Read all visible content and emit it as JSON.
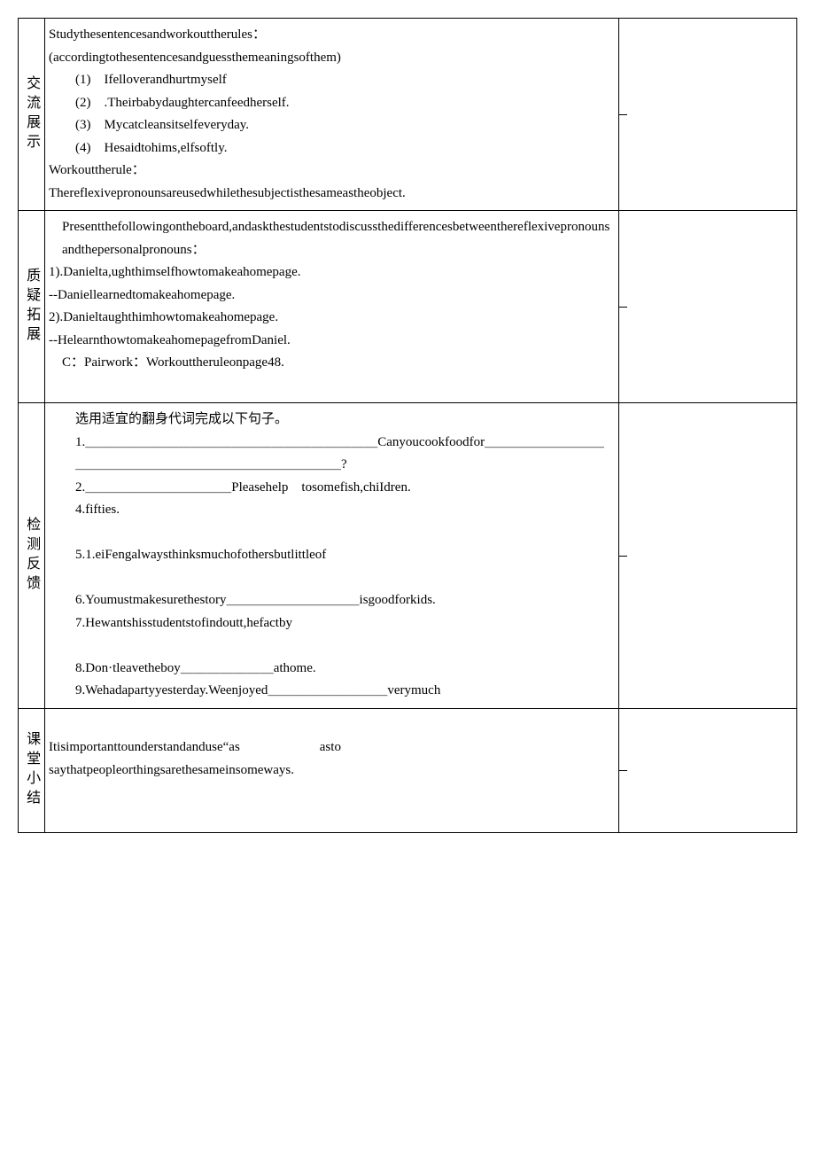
{
  "sections": [
    {
      "label": "交流展示",
      "lines": [
        {
          "text": "Studythesentencesandworkouttherules",
          "suffix": "：",
          "justify": true
        },
        {
          "text": "(accordingtothesentencesandguessthemeaningsofthem)"
        },
        {
          "text": "(1)　Ifelloverandhurtmyself",
          "indent": "indent1"
        },
        {
          "text": "(2)　.Theirbabydaughtercanfeedherself.",
          "indent": "indent1"
        },
        {
          "text": "(3)　Mycatcleansitselfeveryday.",
          "indent": "indent1"
        },
        {
          "text": "(4)　Hesaidtohims,elfsoftly.",
          "indent": "indent1"
        },
        {
          "text": "Workouttherule",
          "suffix": "：",
          "justify": true
        },
        {
          "text": "Thereflexivepronounsareusedwhilethesubjectisthesameastheobject."
        }
      ]
    },
    {
      "label": "质疑拓展",
      "lines": [
        {
          "text": "Presentthefollowingontheboard,andaskthestudentstodiscussthedifferencesbetweenthereflexivepronounsandthepersonalpronouns：",
          "indent": "indent-sm"
        },
        {
          "text": "1).Danielta,ughthimselfhowtomakeahomepage."
        },
        {
          "text": "--Daniellearnedtomakeahomepage."
        },
        {
          "text": "2).Danieltaughthimhowtomakeahomepage."
        },
        {
          "text": "--HelearnthowtomakeahomepagefromDaniel."
        },
        {
          "text": "C：Pairwork：Workouttheruleonpage48.",
          "indent": "indent-sm"
        },
        {
          "text": " "
        }
      ]
    },
    {
      "label": "检测反馈",
      "lines": [
        {
          "text": "选用适宜的翻身代词完成以下句子。",
          "indent": "indent1"
        },
        {
          "text": "1.＿＿＿＿＿＿＿＿＿＿＿＿＿＿＿＿＿＿＿＿＿＿Canyoucookfoodfor＿＿＿＿＿＿＿＿＿＿＿＿＿＿＿＿＿＿＿＿＿＿＿＿＿＿＿＿＿?",
          "indent": "indent1"
        },
        {
          "text": "2.＿＿＿＿＿＿＿＿＿＿＿Pleasehelp　tosomefish,chiIdren.",
          "indent": "indent1"
        },
        {
          "text": "4.fifties.",
          "indent": "indent1"
        },
        {
          "text": " "
        },
        {
          "text": "5.1.eiFengalwaysthinksmuchofothersbutlittleof",
          "indent": "indent1"
        },
        {
          "text": " "
        },
        {
          "text": "6.Youmustmakesurethestory＿＿＿＿＿＿＿＿＿＿isgoodforkids.",
          "indent": "indent1"
        },
        {
          "text": "7.Hewantshisstudentstofindoutt,hefactby",
          "indent": "indent1"
        },
        {
          "text": " "
        },
        {
          "text": "8.Don·tleavetheboy＿＿＿＿＿＿＿athome.",
          "indent": "indent1"
        },
        {
          "text": "9.Wehadapartyyesterday.Weenjoyed＿＿＿＿＿＿＿＿＿verymuch",
          "indent": "indent1"
        }
      ]
    },
    {
      "label": "课堂小结",
      "lines": [
        {
          "text": " "
        },
        {
          "text": "Itisimportanttounderstandanduse“as　　　　　　asto"
        },
        {
          "text": "saythatpeopleorthingsarethesameinsomeways."
        },
        {
          "text": " "
        },
        {
          "text": " "
        }
      ]
    }
  ]
}
